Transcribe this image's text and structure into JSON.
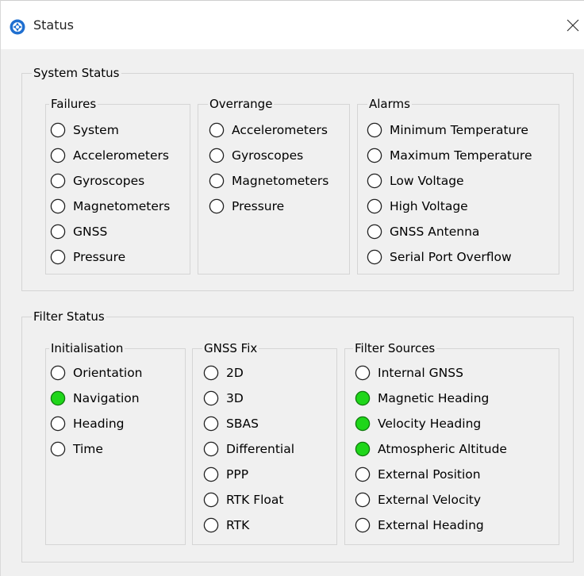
{
  "window": {
    "title": "Status",
    "icon": "app-logo-icon",
    "close_icon": "close-icon"
  },
  "colors": {
    "active": "#1fd61a",
    "active_border": "#0f7a0c",
    "inactive_border": "#222222",
    "group_border": "#d5d5d5",
    "background": "#f0f0f0"
  },
  "system_status": {
    "label": "System Status",
    "failures": {
      "label": "Failures",
      "items": [
        {
          "label": "System",
          "active": false
        },
        {
          "label": "Accelerometers",
          "active": false
        },
        {
          "label": "Gyroscopes",
          "active": false
        },
        {
          "label": "Magnetometers",
          "active": false
        },
        {
          "label": "GNSS",
          "active": false
        },
        {
          "label": "Pressure",
          "active": false
        }
      ]
    },
    "overrange": {
      "label": "Overrange",
      "items": [
        {
          "label": "Accelerometers",
          "active": false
        },
        {
          "label": "Gyroscopes",
          "active": false
        },
        {
          "label": "Magnetometers",
          "active": false
        },
        {
          "label": "Pressure",
          "active": false
        }
      ]
    },
    "alarms": {
      "label": "Alarms",
      "items": [
        {
          "label": "Minimum Temperature",
          "active": false
        },
        {
          "label": "Maximum Temperature",
          "active": false
        },
        {
          "label": "Low Voltage",
          "active": false
        },
        {
          "label": "High Voltage",
          "active": false
        },
        {
          "label": "GNSS Antenna",
          "active": false
        },
        {
          "label": "Serial Port Overflow",
          "active": false
        }
      ]
    }
  },
  "filter_status": {
    "label": "Filter Status",
    "initialisation": {
      "label": "Initialisation",
      "items": [
        {
          "label": "Orientation",
          "active": false
        },
        {
          "label": "Navigation",
          "active": true
        },
        {
          "label": "Heading",
          "active": false
        },
        {
          "label": "Time",
          "active": false
        }
      ]
    },
    "gnss_fix": {
      "label": "GNSS Fix",
      "items": [
        {
          "label": "2D",
          "active": false
        },
        {
          "label": "3D",
          "active": false
        },
        {
          "label": "SBAS",
          "active": false
        },
        {
          "label": "Differential",
          "active": false
        },
        {
          "label": "PPP",
          "active": false
        },
        {
          "label": "RTK Float",
          "active": false
        },
        {
          "label": "RTK",
          "active": false
        }
      ]
    },
    "filter_sources": {
      "label": "Filter Sources",
      "items": [
        {
          "label": "Internal GNSS",
          "active": false
        },
        {
          "label": "Magnetic Heading",
          "active": true
        },
        {
          "label": "Velocity Heading",
          "active": true
        },
        {
          "label": "Atmospheric Altitude",
          "active": true
        },
        {
          "label": "External Position",
          "active": false
        },
        {
          "label": "External Velocity",
          "active": false
        },
        {
          "label": "External Heading",
          "active": false
        }
      ]
    }
  }
}
